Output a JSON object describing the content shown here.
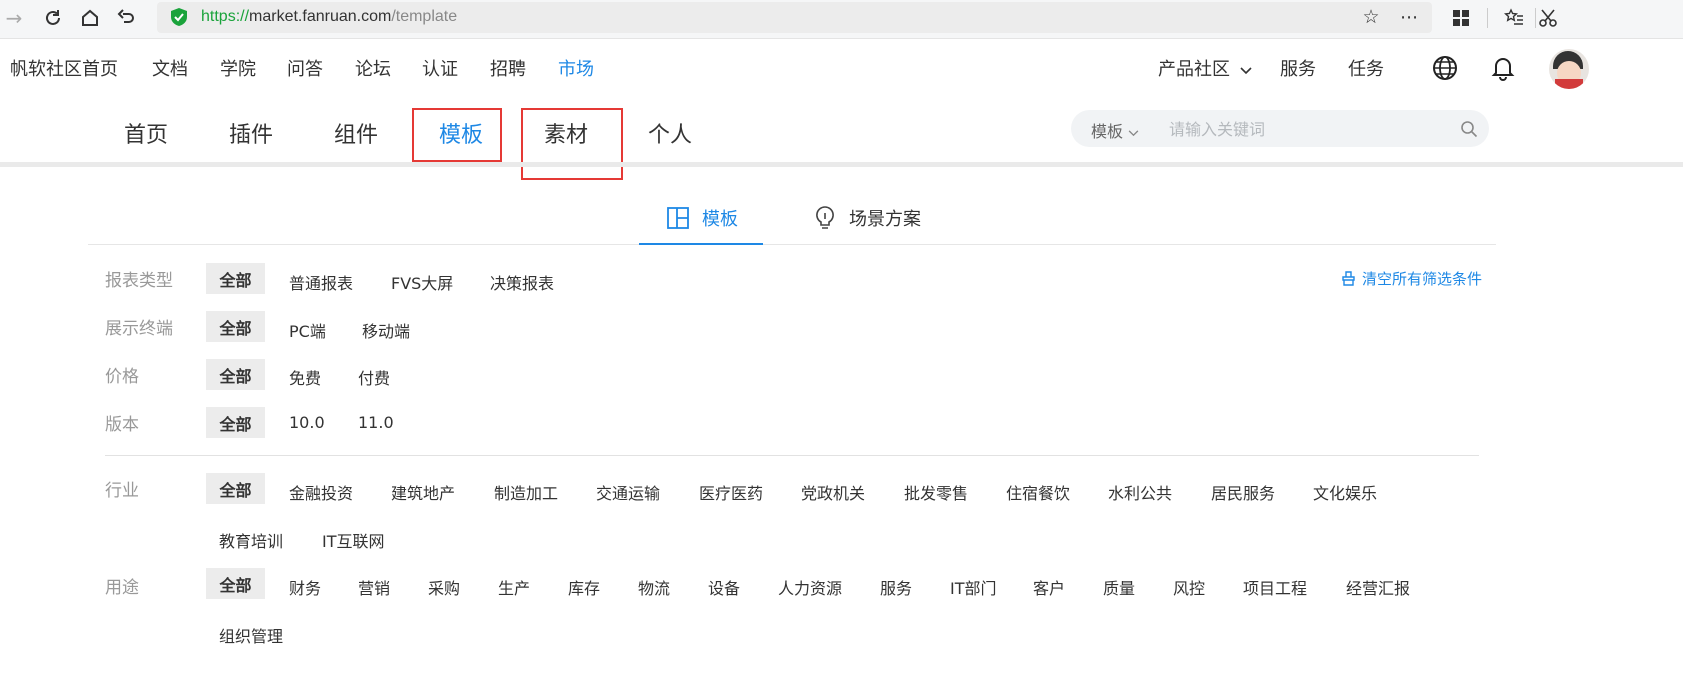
{
  "browser": {
    "url_scheme": "https://",
    "url_host": "market.fanruan.com",
    "url_path": "/template"
  },
  "topnav": {
    "items": [
      "帆软社区首页",
      "文档",
      "学院",
      "问答",
      "论坛",
      "认证",
      "招聘",
      "市场"
    ],
    "active": "市场",
    "right": {
      "product_community": "产品社区",
      "service": "服务",
      "task": "任务"
    }
  },
  "subnav": {
    "items": [
      "首页",
      "插件",
      "组件",
      "模板",
      "素材",
      "个人"
    ],
    "active": "模板"
  },
  "search": {
    "type": "模板",
    "placeholder": "请输入关键词"
  },
  "tabs": {
    "template": "模板",
    "scenario": "场景方案",
    "active": "模板"
  },
  "clear_filters": "清空所有筛选条件",
  "filters": {
    "report_type": {
      "label": "报表类型",
      "all": "全部",
      "options": [
        "普通报表",
        "FVS大屏",
        "决策报表"
      ]
    },
    "terminal": {
      "label": "展示终端",
      "all": "全部",
      "options": [
        "PC端",
        "移动端"
      ]
    },
    "price": {
      "label": "价格",
      "all": "全部",
      "options": [
        "免费",
        "付费"
      ]
    },
    "version": {
      "label": "版本",
      "all": "全部",
      "options": [
        "10.0",
        "11.0"
      ]
    },
    "industry": {
      "label": "行业",
      "all": "全部",
      "options": [
        "金融投资",
        "建筑地产",
        "制造加工",
        "交通运输",
        "医疗医药",
        "党政机关",
        "批发零售",
        "住宿餐饮",
        "水利公共",
        "居民服务",
        "文化娱乐",
        "教育培训",
        "IT互联网"
      ]
    },
    "usage": {
      "label": "用途",
      "all": "全部",
      "options": [
        "财务",
        "营销",
        "采购",
        "生产",
        "库存",
        "物流",
        "设备",
        "人力资源",
        "服务",
        "IT部门",
        "客户",
        "质量",
        "风控",
        "项目工程",
        "经营汇报",
        "组织管理"
      ]
    }
  },
  "colors": {
    "accent": "#1e88e5",
    "highlight": "#e53935",
    "secure": "#1aa33b"
  }
}
